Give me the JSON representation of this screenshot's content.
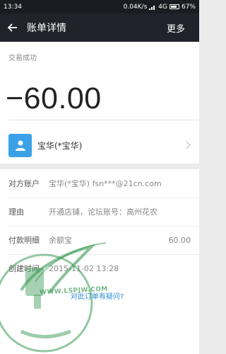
{
  "status_bar": {
    "time": "13:34",
    "network_speed": "0.04K/s",
    "signal_type": "4G",
    "battery": "67%"
  },
  "nav": {
    "title": "账单详情",
    "more_label": "更多"
  },
  "transaction": {
    "status": "交易成功",
    "amount": "−60.00",
    "counterparty_name": "宝华(*宝华)"
  },
  "details": [
    {
      "label": "对方账户",
      "value": "宝华(*宝华) fsn***@21cn.com"
    },
    {
      "label": "理由",
      "value": "开通店铺，论坛账号：高州花农"
    },
    {
      "label": "付款明细",
      "value": "余额宝",
      "amount": "60.00"
    },
    {
      "label": "创建时间",
      "value": "2015-11-02 13:28"
    }
  ],
  "question_link": "对此订单有疑问?",
  "watermark": {
    "site": "WWW.LSPJW.COM",
    "colors": {
      "green": "#3a9a55"
    }
  },
  "colors": {
    "nav_bg": "#20232a",
    "avatar_blue": "#3ba1e7",
    "link_blue": "#2a8cd6"
  }
}
